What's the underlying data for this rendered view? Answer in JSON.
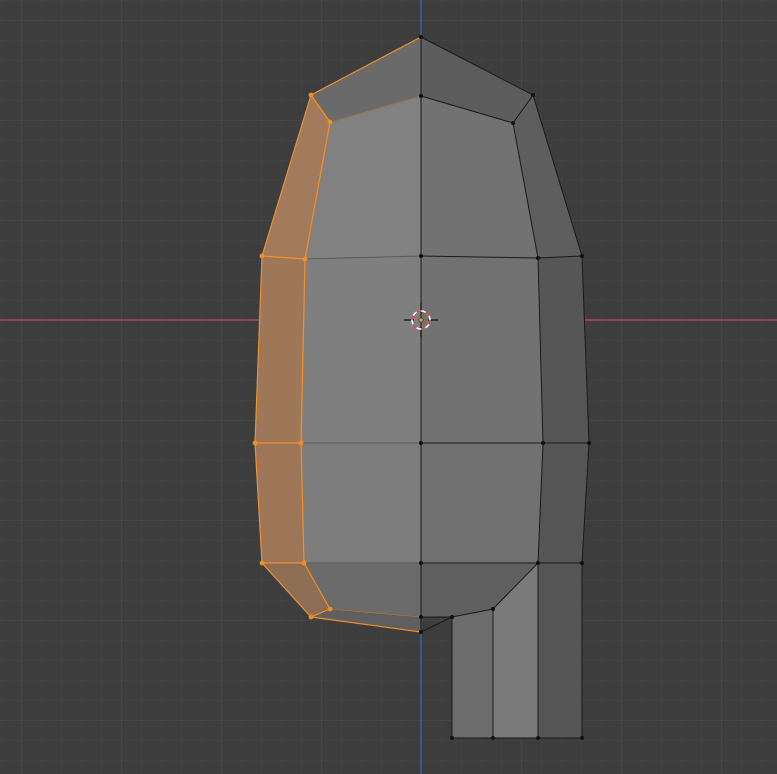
{
  "viewport": {
    "mode": "edit-mode",
    "view": "front-orthographic",
    "shading": "solid",
    "background_color": "#3d3d3d",
    "grid_minor_color": "#444444",
    "grid_major_color": "#4c4c4c",
    "axis_x_color": "#c4495a",
    "axis_z_color": "#3a6fb8",
    "selection_color": "#f0902a",
    "selected_face_tint": "#a87752"
  },
  "icons": {
    "cursor": "3d-cursor-icon",
    "origin": "object-origin-icon"
  }
}
